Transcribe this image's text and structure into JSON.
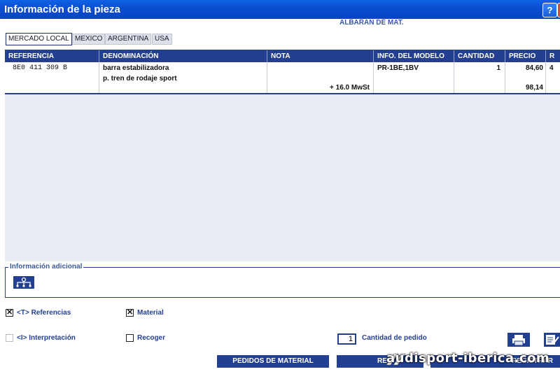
{
  "window": {
    "title": "Información de la pieza",
    "help_label": "?",
    "close_label": "×"
  },
  "subheader": "ALBARÁN DE MAT.",
  "tabs": [
    {
      "label": "MERCADO LOCAL",
      "active": true
    },
    {
      "label": "MEXICO",
      "active": false
    },
    {
      "label": "ARGENTINA",
      "active": false
    },
    {
      "label": "USA",
      "active": false
    }
  ],
  "table": {
    "columns": [
      "REFERENCIA",
      "DENOMINACIÓN",
      "NOTA",
      "INFO. DEL MODELO",
      "CANTIDAD",
      "PRECIO",
      "R"
    ],
    "rows": [
      {
        "referencia": "8E0 411 309 B",
        "denominacion_1": "barra estabilizadora",
        "denominacion_2": "p. tren de rodaje sport",
        "nota": "+ 16.0 MwSt",
        "info_modelo": "PR-1BE,1BV",
        "cantidad": "1",
        "precio": "84,60",
        "precio_total": "98,14",
        "r": "4"
      }
    ]
  },
  "info_adicional": {
    "label": "Información adicional",
    "icon": "hierarchy-icon"
  },
  "options": {
    "referencias": {
      "label": "<T> Referencias",
      "checked": true
    },
    "material": {
      "label": "Material",
      "checked": true
    },
    "interpretacion": {
      "label": "<I> Interpretación",
      "checked": false,
      "enabled": false
    },
    "recoger": {
      "label": "Recoger",
      "checked": false
    }
  },
  "cantidad_pedido": {
    "value": "1",
    "label": "Cantidad de pedido"
  },
  "buttons": {
    "pedidos": "PEDIDOS DE MATERIAL",
    "second_partial": "RE",
    "third_partial": "REGISTRAR"
  },
  "toolbar_icons": [
    "printer-icon",
    "edit-list-icon"
  ],
  "watermark": "audisport-iberica.com",
  "colors": {
    "accent": "#233f92",
    "titlebar": "#0a4fd0",
    "grid_bg": "#e9ecf3"
  }
}
